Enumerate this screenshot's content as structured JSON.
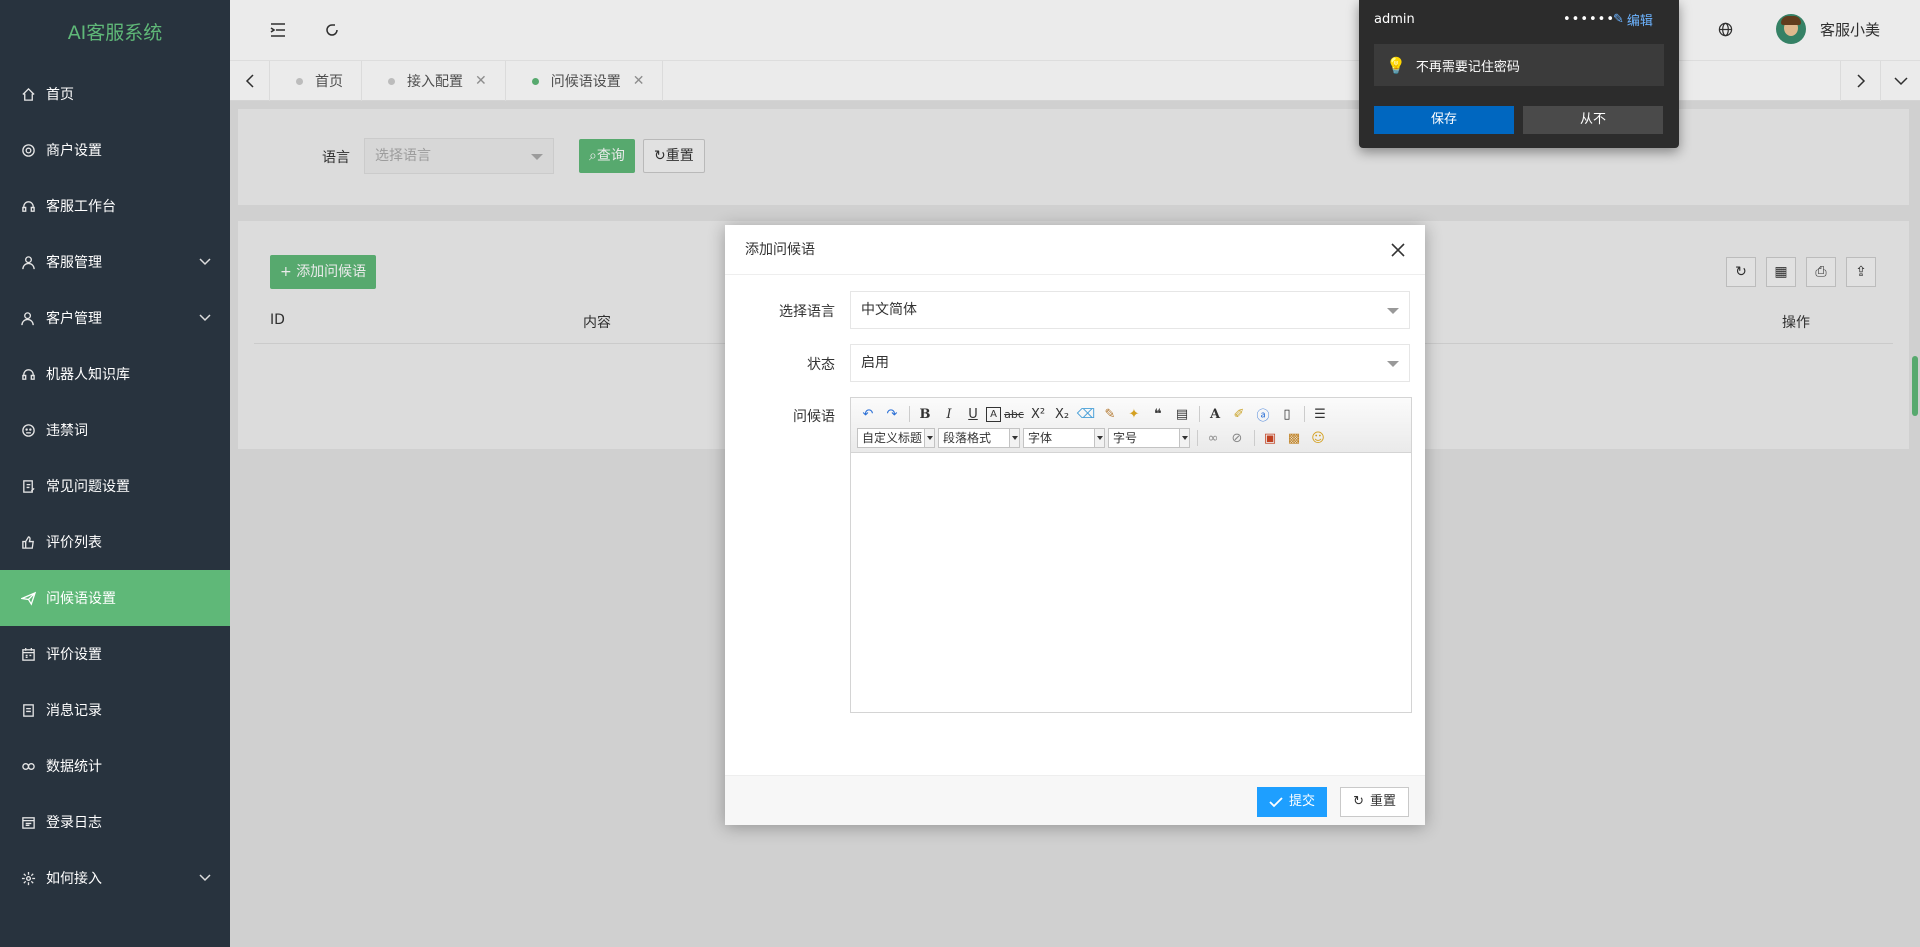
{
  "app": {
    "title": "AI客服系统"
  },
  "sidebar": {
    "items": [
      {
        "label": "首页",
        "icon": "home-icon"
      },
      {
        "label": "商户设置",
        "icon": "gear-icon"
      },
      {
        "label": "客服工作台",
        "icon": "headset-icon"
      },
      {
        "label": "客服管理",
        "icon": "user-icon",
        "expandable": true
      },
      {
        "label": "客户管理",
        "icon": "user-group-icon",
        "expandable": true
      },
      {
        "label": "机器人知识库",
        "icon": "headset-icon"
      },
      {
        "label": "违禁词",
        "icon": "face-icon"
      },
      {
        "label": "常见问题设置",
        "icon": "doc-edit-icon"
      },
      {
        "label": "评价列表",
        "icon": "thumb-up-icon"
      },
      {
        "label": "问候语设置",
        "icon": "send-icon",
        "active": true
      },
      {
        "label": "评价设置",
        "icon": "calendar-icon"
      },
      {
        "label": "消息记录",
        "icon": "list-icon"
      },
      {
        "label": "数据统计",
        "icon": "link-icon"
      },
      {
        "label": "登录日志",
        "icon": "log-icon"
      },
      {
        "label": "如何接入",
        "icon": "settings-icon",
        "expandable": true
      }
    ]
  },
  "header": {
    "username": "客服小美"
  },
  "tabs": [
    {
      "label": "首页",
      "closable": false
    },
    {
      "label": "接入配置",
      "closable": true
    },
    {
      "label": "问候语设置",
      "closable": true,
      "active": true
    }
  ],
  "search": {
    "language_label": "语言",
    "language_placeholder": "选择语言",
    "query_button": "查询",
    "reset_button": "重置"
  },
  "table": {
    "add_button": "添加问候语",
    "columns": [
      "ID",
      "内容",
      "操作"
    ]
  },
  "modal": {
    "title": "添加问候语",
    "language_label": "选择语言",
    "language_value": "中文简体",
    "status_label": "状态",
    "status_value": "启用",
    "greeting_label": "问候语",
    "editor": {
      "combo_heading": "自定义标题",
      "combo_paragraph": "段落格式",
      "combo_font": "字体",
      "combo_size": "字号"
    },
    "submit_button": "提交",
    "reset_button": "重置"
  },
  "password_prompt": {
    "username": "admin",
    "password_mask": "••••••",
    "edit_label": "编辑",
    "message": "不再需要记住密码",
    "save_button": "保存",
    "never_button": "从不"
  },
  "colors": {
    "sidebar_bg": "#28333e",
    "accent_green": "#5fb878",
    "primary_blue": "#1e9fff"
  }
}
